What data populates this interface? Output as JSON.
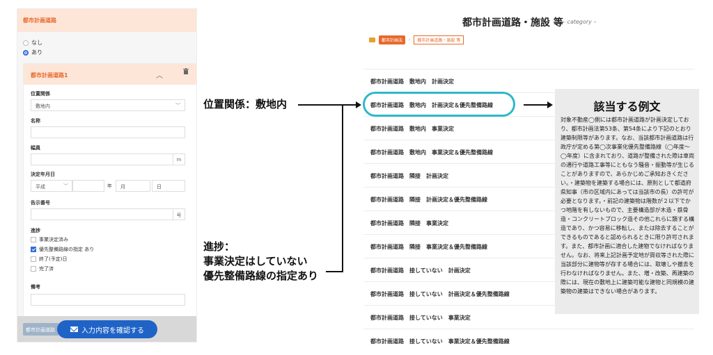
{
  "form": {
    "section_title": "都市計画道路",
    "radio_options": [
      {
        "label": "なし",
        "selected": false
      },
      {
        "label": "あり",
        "selected": true
      }
    ],
    "road_card": {
      "title": "都市計画道路1",
      "chevron_icon": "chevron-up-icon",
      "trash_icon": "trash-icon",
      "position_label": "位置関係",
      "position_value": "敷地内",
      "name_label": "名称",
      "name_value": "",
      "width_label": "幅員",
      "width_unit": "m",
      "date_label": "決定年月日",
      "era_value": "平成",
      "year_unit": "年",
      "month_unit": "月",
      "day_unit": "日",
      "notice_label": "告示番号",
      "notice_unit": "号",
      "progress_label": "進捗",
      "progress_options": [
        {
          "label": "事業決定済み",
          "checked": false
        },
        {
          "label": "優先整備路線の指定 あり",
          "checked": true
        },
        {
          "label": "終了(予定)日",
          "checked": false
        },
        {
          "label": "完了済",
          "checked": false
        }
      ],
      "remarks_label": "備考"
    },
    "footer_tag": "都市計画道路",
    "confirm_button": "入力内容を確認する",
    "mail_icon": "mail-icon"
  },
  "annotations": {
    "position": "位置関係：敷地内",
    "progress_lines": [
      "進捗：",
      "事業決定はしていない",
      "優先整備路線の指定あり"
    ]
  },
  "category": {
    "title": "都市計画道路・施設 等",
    "subtitle": "– category –",
    "folder_icon": "folder-icon",
    "breadcrumb": [
      "都市計画法",
      "都市計画道路・施設 等"
    ],
    "breadcrumb_separator": "›",
    "rows": [
      "都市計画道路　敷地内　計画決定",
      "都市計画道路　敷地内　計画決定＆優先整備路線",
      "都市計画道路　敷地内　事業決定",
      "都市計画道路　敷地内　事業決定＆優先整備路線",
      "都市計画道路　隣接　計画決定",
      "都市計画道路　隣接　計画決定＆優先整備路線",
      "都市計画道路　隣接　事業決定",
      "都市計画道路　隣接　事業決定＆優先整備路線",
      "都市計画道路　接していない　計画決定",
      "都市計画道路　接していない　計画決定＆優先整備路線",
      "都市計画道路　接していない　事業決定",
      "都市計画道路　接していない　事業決定＆優先整備路線"
    ],
    "highlight_color": "#2db8c9"
  },
  "example": {
    "title": "該当する例文",
    "text": "対象不動産◯側には都市計画道路が計画決定しており、都市計画法第53条、第54条により下記のとおり建築制限等があります。なお、当該都市計画道路は行政庁が定める第◯次事業化優先整備路線（◯年度～◯年度）に含まれており、道路が整備された際は車両の通行や道路工事等にともなう騒音・振動等が生じることがありますので、あらかじめご承知おきください。・建築物を建築する場合には、原則として都道府県知事（市の区域内にあっては当該市の長）の許可が必要となります。・前記の建築物は階数が２以下でかつ地階を有しないもので、主要構造部が木造・鉄骨造・コンクリートブロック造その他これらに類する構造であり、かつ容易に移転し、または除去することができるものであると認められるときに限り許可されます。また、都市計画に適合した建物でなければなりません。なお、将来上記計画予定地が買収等された際に当該部分に建物等が存する場合には、取壊しや撤去を行わなければなりません。また、増・改築、再建築の際には、現在の敷地上に建築可能な建物と同規模の建築物の建築はできない場合があります。"
  }
}
